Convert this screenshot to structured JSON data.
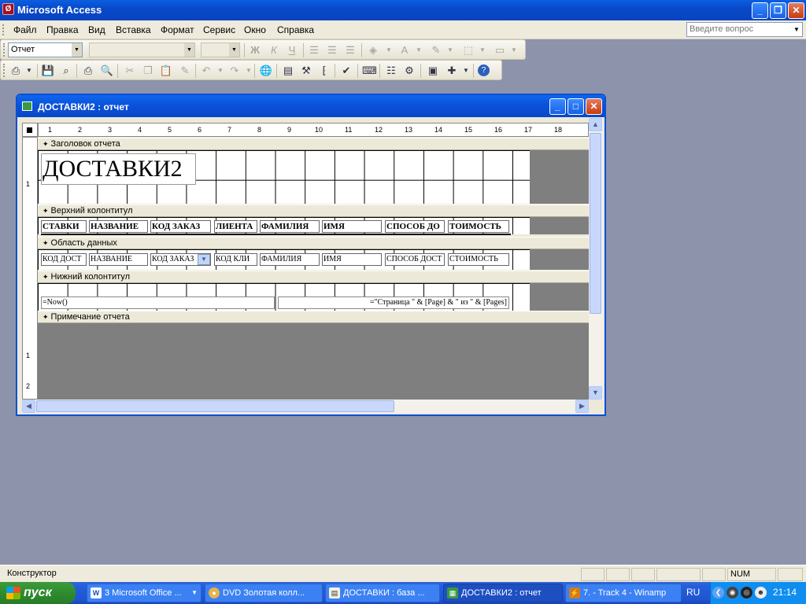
{
  "app": {
    "title": "Microsoft Access",
    "icon_glyph": "Ø"
  },
  "menu": {
    "items": [
      "Файл",
      "Правка",
      "Вид",
      "Вставка",
      "Формат",
      "Сервис",
      "Окно",
      "Справка"
    ],
    "help_placeholder": "Введите вопрос"
  },
  "toolbar1": {
    "object_combo": "Отчет",
    "font_combo": "",
    "size_combo": ""
  },
  "report_window": {
    "title": "ДОСТАВКИ2 : отчет"
  },
  "ruler": {
    "ticks": [
      "1",
      "2",
      "3",
      "4",
      "5",
      "6",
      "7",
      "8",
      "9",
      "10",
      "11",
      "12",
      "13",
      "14",
      "15",
      "16",
      "17",
      "18"
    ],
    "vticks": [
      "1",
      "1",
      "2"
    ]
  },
  "sections": {
    "report_header": "Заголовок отчета",
    "page_header": "Верхний колонтитул",
    "detail": "Область данных",
    "page_footer": "Нижний колонтитул",
    "report_footer": "Примечание отчета"
  },
  "report_title_label": "ДОСТАВКИ2",
  "page_header_labels": [
    "СТАВКИ",
    "НАЗВАНИЕ",
    "КОД ЗАКАЗ",
    "ЛИЕНТА",
    "ФАМИЛИЯ",
    "ИМЯ",
    "СПОСОБ ДО",
    "ТОИМОСТЬ"
  ],
  "detail_fields": [
    "КОД ДОСТ",
    "НАЗВАНИЕ",
    "КОД ЗАКАЗ",
    "КОД КЛИ",
    "ФАМИЛИЯ",
    "ИМЯ",
    "СПОСОБ ДОСТ",
    "СТОИМОСТЬ"
  ],
  "footer_fields": {
    "left": "=Now()",
    "right": "=\"Страница \" & [Page] & \" из \" & [Pages]"
  },
  "status": {
    "mode": "Конструктор",
    "num": "NUM"
  },
  "taskbar": {
    "start": "пуск",
    "tasks": [
      "3 Microsoft Office ...",
      "DVD  Золотая колл...",
      "ДОСТАВКИ : база ...",
      "ДОСТАВКИ2 : отчет",
      "7.  - Track 4 - Winamp"
    ],
    "lang": "RU",
    "clock": "21:14"
  }
}
